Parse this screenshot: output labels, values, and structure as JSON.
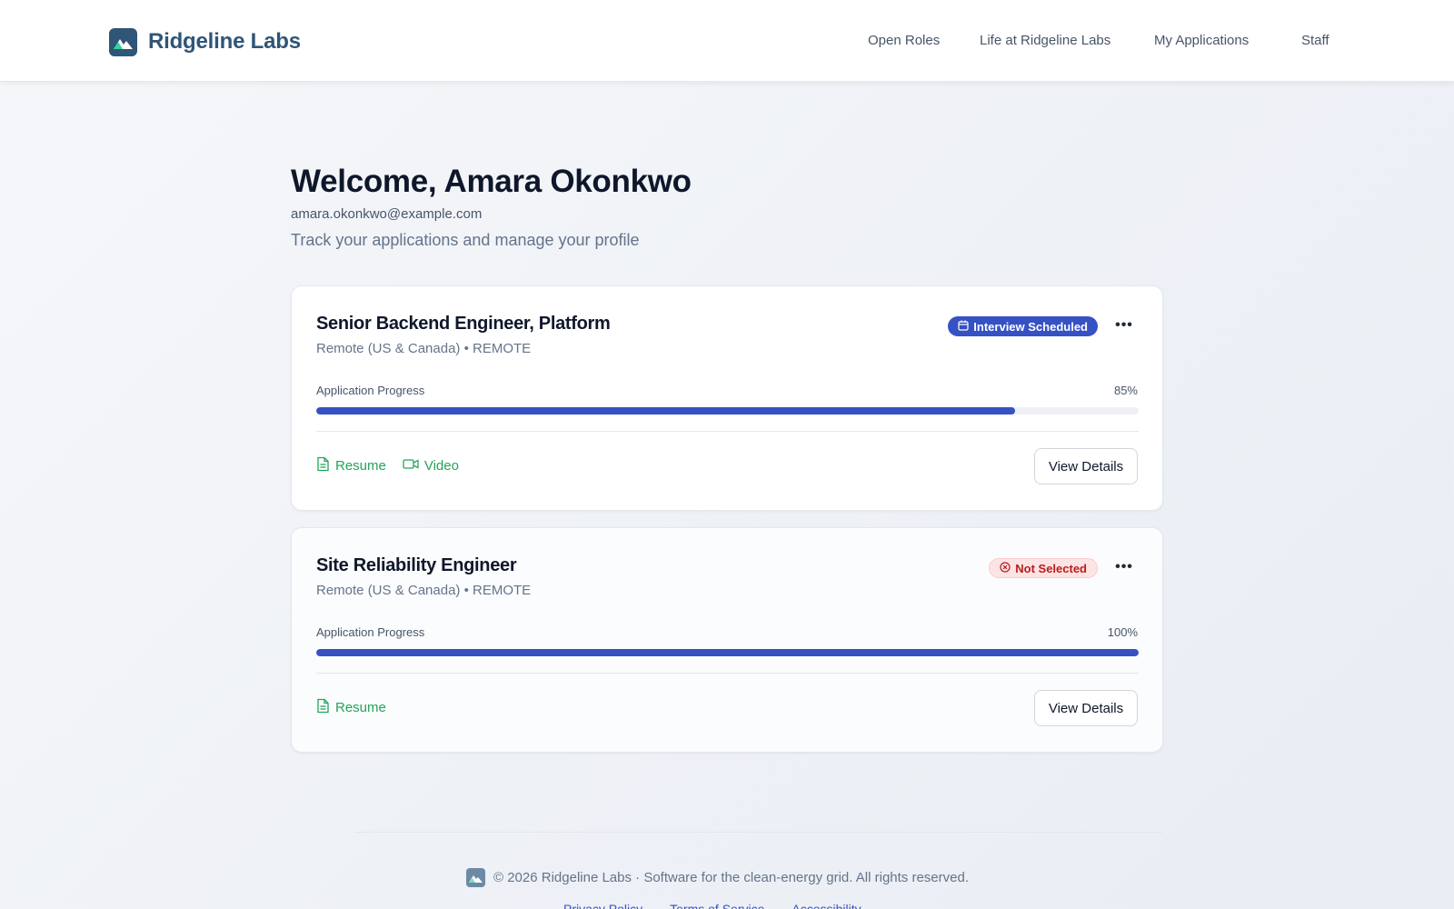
{
  "header": {
    "brand": "Ridgeline Labs",
    "brand_color": "#2f5577",
    "nav": [
      "Open Roles",
      "Life at Ridgeline Labs",
      "My Applications",
      "Staff"
    ]
  },
  "profile": {
    "welcome": "Welcome, Amara Okonkwo",
    "email": "amara.okonkwo@example.com",
    "tagline": "Track your applications and manage your profile"
  },
  "applications": [
    {
      "title": "Senior Backend Engineer, Platform",
      "meta": "Remote (US & Canada) • REMOTE",
      "status": "Interview Scheduled",
      "status_icon": "calendar-icon",
      "status_color": "#3651c4",
      "progress_label": "Application Progress",
      "progress": 85,
      "progress_text": "85%",
      "attachments": [
        {
          "label": "Resume",
          "icon": "document-icon"
        },
        {
          "label": "Video",
          "icon": "video-icon"
        }
      ],
      "action": "View Details"
    },
    {
      "title": "Site Reliability Engineer",
      "meta": "Remote (US & Canada) • REMOTE",
      "status": "Not Selected",
      "status_icon": "x-circle-icon",
      "status_color": "#b91c1c",
      "progress_label": "Application Progress",
      "progress": 100,
      "progress_text": "100%",
      "attachments": [
        {
          "label": "Resume",
          "icon": "document-icon"
        }
      ],
      "action": "View Details"
    }
  ],
  "footer": {
    "text": "© 2026 Ridgeline Labs · Software for the clean-energy grid. All rights reserved.",
    "links": [
      "Privacy Policy",
      "Terms of Service",
      "Accessibility"
    ]
  },
  "colors": {
    "accent": "#3651c4",
    "success": "#22a55a",
    "danger": "#b91c1c"
  }
}
